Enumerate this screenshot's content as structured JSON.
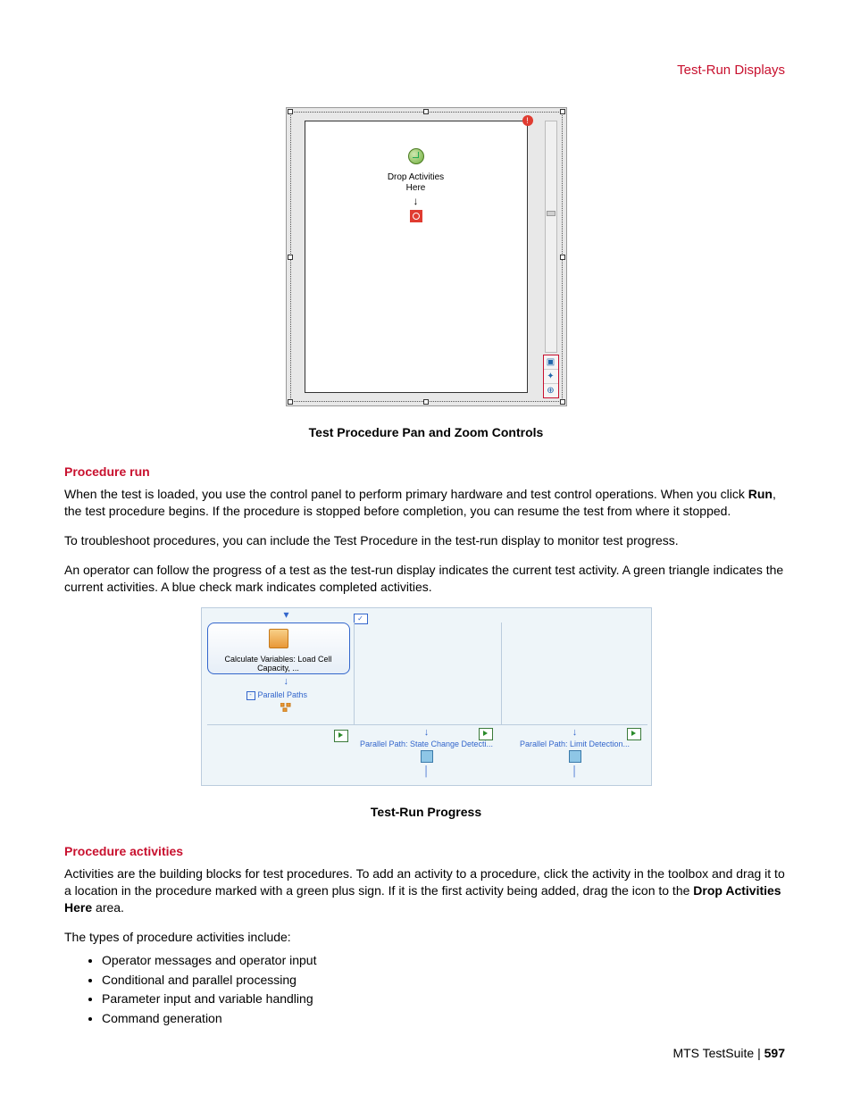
{
  "header": {
    "section_title": "Test-Run Displays"
  },
  "figure1": {
    "drop_label_line1": "Drop Activities",
    "drop_label_line2": "Here",
    "caption": "Test Procedure Pan and Zoom Controls"
  },
  "section_procedure_run": {
    "heading": "Procedure run",
    "p1_a": "When the test is loaded, you use the control panel to perform primary hardware and test control operations. When you click ",
    "p1_bold": "Run",
    "p1_b": ", the test procedure begins. If the procedure is stopped before completion, you can resume the test from where it stopped.",
    "p2": "To troubleshoot procedures, you can include the Test Procedure in the test-run display to monitor test progress.",
    "p3": "An operator can follow the progress of a test as the test-run display indicates the current test activity. A green triangle indicates the current activities. A blue check mark indicates completed activities."
  },
  "figure2": {
    "calc_label": "Calculate Variables: Load Cell Capacity, ...",
    "parallel_paths_label": "Parallel Paths",
    "col2_label": "Parallel Path: State Change Detecti...",
    "col3_label": "Parallel Path: Limit Detection...",
    "caption": "Test-Run Progress"
  },
  "section_procedure_activities": {
    "heading": "Procedure activities",
    "p1_a": "Activities are the building blocks for test procedures. To add an activity to a procedure, click the activity in the toolbox and drag it to a location in the procedure marked with a green plus sign. If it is the first activity being added, drag the icon to the ",
    "p1_bold": "Drop Activities Here",
    "p1_b": " area.",
    "p2": "The types of procedure activities include:",
    "bullets": [
      "Operator messages and operator input",
      "Conditional and parallel processing",
      "Parameter input and variable handling",
      "Command generation"
    ]
  },
  "footer": {
    "product": "MTS TestSuite",
    "sep": " | ",
    "page": "597"
  }
}
